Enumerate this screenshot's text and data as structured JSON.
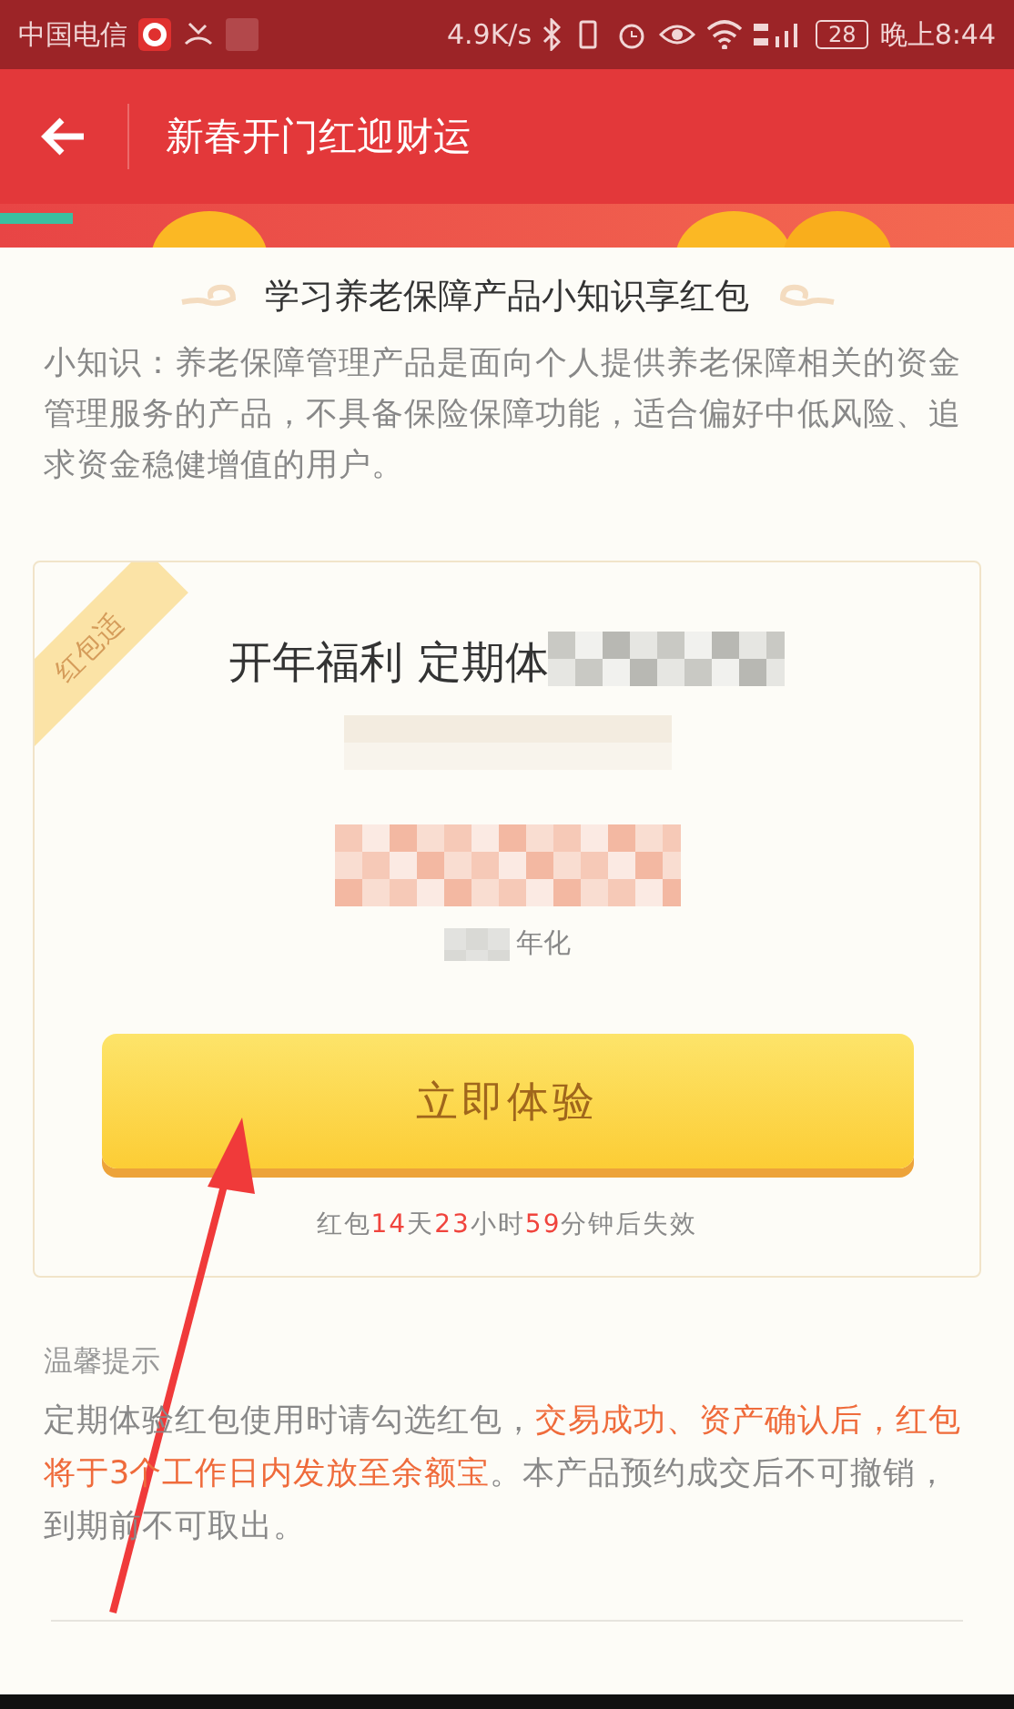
{
  "status_bar": {
    "carrier": "中国电信",
    "speed": "4.9K/s",
    "battery": "28",
    "time": "晚上8:44"
  },
  "header": {
    "title": "新春开门红迎财运"
  },
  "intro": {
    "heading": "学习养老保障产品小知识享红包",
    "text": "小知识：养老保障管理产品是面向个人提供养老保障相关的资金管理服务的产品，不具备保险保障功能，适合偏好中低风险、追求资金稳健增值的用户。"
  },
  "coupon": {
    "ribbon": "红包适",
    "title": "开年福利 定期体",
    "rate_label": "年化",
    "button": "立即体验",
    "countdown": [
      {
        "text": "红包",
        "highlight": false
      },
      {
        "text": "14",
        "highlight": true
      },
      {
        "text": "天",
        "highlight": false
      },
      {
        "text": "23",
        "highlight": true
      },
      {
        "text": "小时",
        "highlight": false
      },
      {
        "text": "59",
        "highlight": true
      },
      {
        "text": "分钟后失效",
        "highlight": false
      }
    ]
  },
  "tips": {
    "heading": "温馨提示",
    "segments": [
      {
        "text": "定期体验红包使用时请勾选红包，",
        "highlight": false
      },
      {
        "text": "交易成功、资产确认后，红包将于3个工作日内发放至余额宝",
        "highlight": true
      },
      {
        "text": "。本产品预约成交后不可撤销，到期前不可取出。",
        "highlight": false
      }
    ]
  }
}
